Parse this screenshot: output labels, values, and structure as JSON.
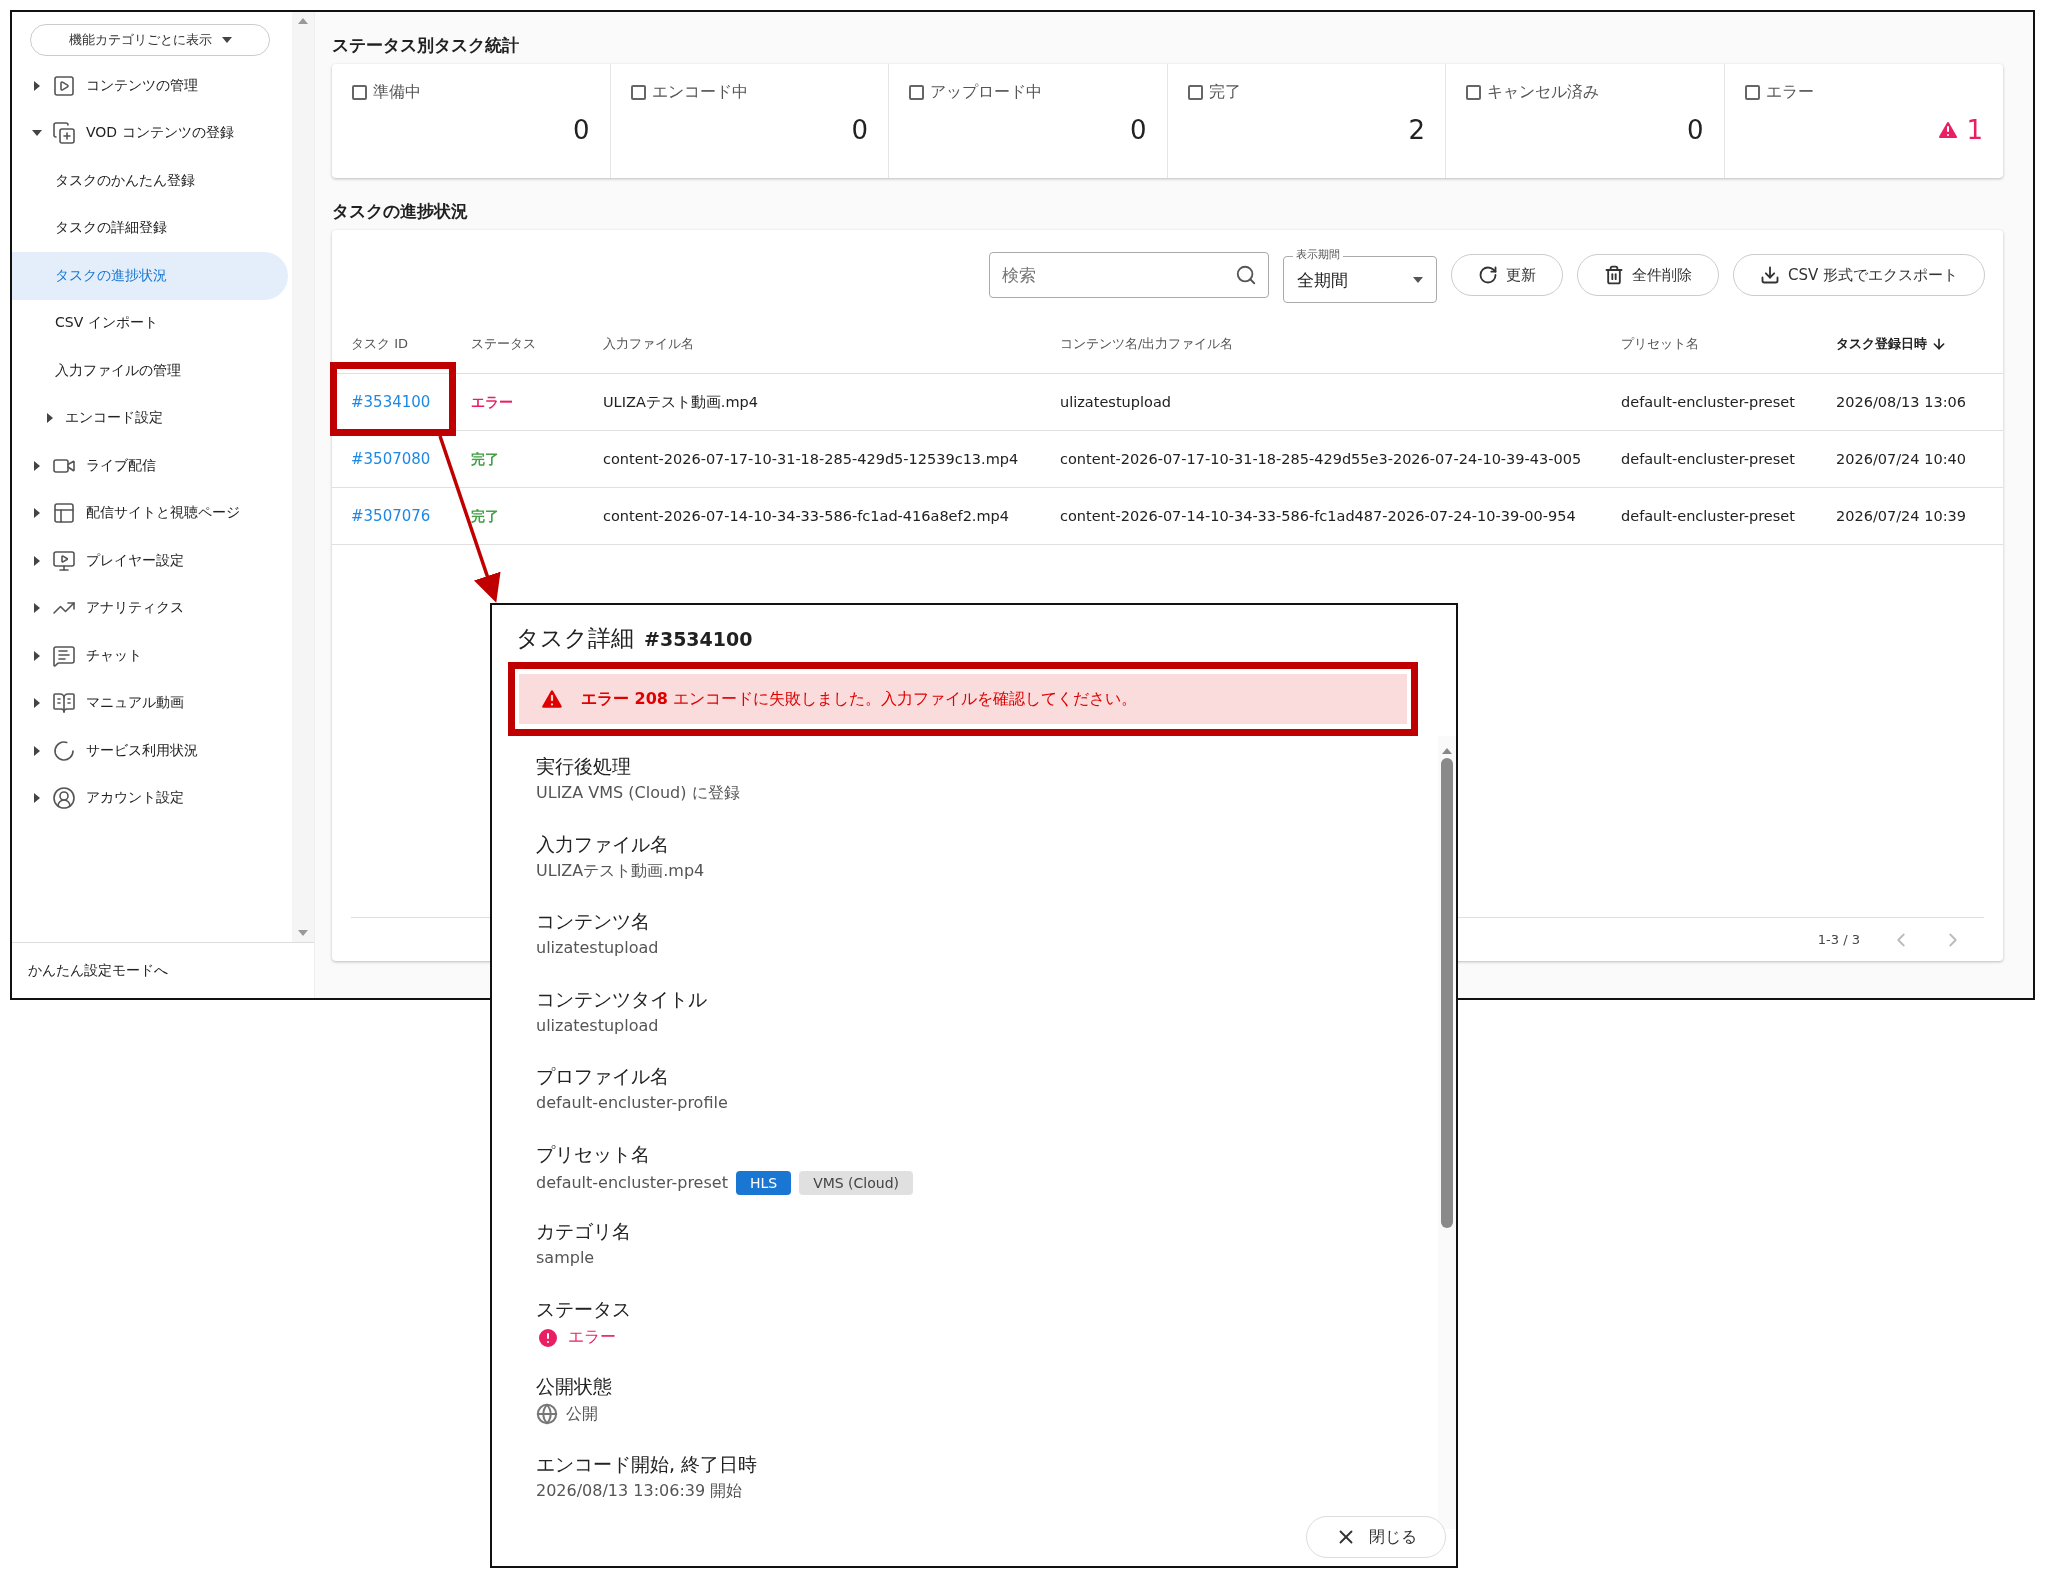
{
  "sidebar": {
    "view_select": "機能カテゴリごとに表示",
    "items": [
      {
        "label": "コンテンツの管理",
        "expanded": false,
        "selected": false
      },
      {
        "label": "VOD コンテンツの登録",
        "expanded": true,
        "selected": false,
        "children": [
          {
            "label": "タスクのかんたん登録",
            "selected": false
          },
          {
            "label": "タスクの詳細登録",
            "selected": false
          },
          {
            "label": "タスクの進捗状況",
            "selected": true
          },
          {
            "label": "CSV インポート",
            "selected": false
          },
          {
            "label": "入力ファイルの管理",
            "selected": false
          },
          {
            "label": "エンコード設定",
            "selected": false,
            "expanded": false
          }
        ]
      },
      {
        "label": "ライブ配信",
        "expanded": false,
        "selected": false
      },
      {
        "label": "配信サイトと視聴ページ",
        "expanded": false,
        "selected": false
      },
      {
        "label": "プレイヤー設定",
        "expanded": false,
        "selected": false
      },
      {
        "label": "アナリティクス",
        "expanded": false,
        "selected": false
      },
      {
        "label": "チャット",
        "expanded": false,
        "selected": false
      },
      {
        "label": "マニュアル動画",
        "expanded": false,
        "selected": false
      },
      {
        "label": "サービス利用状況",
        "expanded": false,
        "selected": false
      },
      {
        "label": "アカウント設定",
        "expanded": false,
        "selected": false
      }
    ],
    "footer_link": "かんたん設定モードへ"
  },
  "stats": {
    "title": "ステータス別タスク統計",
    "cards": [
      {
        "label": "準備中",
        "checked": false,
        "count": "0",
        "kind": "normal"
      },
      {
        "label": "エンコード中",
        "checked": false,
        "count": "0",
        "kind": "normal"
      },
      {
        "label": "アップロード中",
        "checked": false,
        "count": "0",
        "kind": "normal"
      },
      {
        "label": "完了",
        "checked": false,
        "count": "2",
        "kind": "normal"
      },
      {
        "label": "キャンセル済み",
        "checked": false,
        "count": "0",
        "kind": "normal"
      },
      {
        "label": "エラー",
        "checked": false,
        "count": "1",
        "kind": "error"
      }
    ]
  },
  "progress": {
    "title": "タスクの進捗状況",
    "search": {
      "placeholder": "検索"
    },
    "period": {
      "label": "表示期間",
      "value": "全期間"
    },
    "buttons": [
      {
        "label": "更新"
      },
      {
        "label": "全件削除"
      },
      {
        "label": "CSV 形式でエクスポート"
      }
    ],
    "table": {
      "columns": [
        {
          "label": "タスク ID",
          "sorted": false
        },
        {
          "label": "ステータス",
          "sorted": false
        },
        {
          "label": "入力ファイル名",
          "sorted": false
        },
        {
          "label": "コンテンツ名/出力ファイル名",
          "sorted": false
        },
        {
          "label": "プリセット名",
          "sorted": false
        },
        {
          "label": "タスク登録日時",
          "sorted": true
        }
      ],
      "rows": [
        {
          "id": "#3534100",
          "status": "エラー",
          "color": "#e91e63",
          "input": "ULIZAテスト動画.mp4",
          "output": "ulizatestupload",
          "preset": "default-encluster-preset",
          "date": "2026/08/13 13:06"
        },
        {
          "id": "#3507080",
          "status": "完了",
          "color": "#43a047",
          "input": "content-2026-07-17-10-31-18-285-429d5-12539c13.mp4",
          "output": "content-2026-07-17-10-31-18-285-429d55e3-2026-07-24-10-39-43-005",
          "preset": "default-encluster-preset",
          "date": "2026/07/24 10:40"
        },
        {
          "id": "#3507076",
          "status": "完了",
          "color": "#43a047",
          "input": "content-2026-07-14-10-34-33-586-fc1ad-416a8ef2.mp4",
          "output": "content-2026-07-14-10-34-33-586-fc1ad487-2026-07-24-10-39-00-954",
          "preset": "default-encluster-preset",
          "date": "2026/07/24 10:39"
        }
      ]
    },
    "pagination": "1-3 / 3"
  },
  "dialog": {
    "title": "タスク詳細",
    "task_id": "#3534100",
    "alert": {
      "code": "エラー 208",
      "message": "エンコードに失敗しました。入力ファイルを確認してください。"
    },
    "fields": [
      {
        "kind": "text",
        "label": "実行後処理",
        "value": "ULIZA VMS (Cloud) に登録"
      },
      {
        "kind": "text",
        "label": "入力ファイル名",
        "value": "ULIZAテスト動画.mp4"
      },
      {
        "kind": "text",
        "label": "コンテンツ名",
        "value": "ulizatestupload"
      },
      {
        "kind": "text",
        "label": "コンテンツタイトル",
        "value": "ulizatestupload"
      },
      {
        "kind": "text",
        "label": "プロファイル名",
        "value": "default-encluster-profile"
      },
      {
        "kind": "tags",
        "label": "プリセット名",
        "value": "default-encluster-preset",
        "tags": [
          {
            "label": "HLS",
            "color": "#1976d2"
          },
          {
            "label": "VMS (Cloud)",
            "color": "#e0e0e0"
          }
        ]
      },
      {
        "kind": "text",
        "label": "カテゴリ名",
        "value": "sample"
      },
      {
        "kind": "status",
        "label": "ステータス",
        "value": "エラー"
      },
      {
        "kind": "visibility",
        "label": "公開状態",
        "value": "公開"
      },
      {
        "kind": "text",
        "label": "エンコード開始, 終了日時",
        "value": "2026/08/13 13:06:39 開始"
      }
    ],
    "close": "閉じる"
  }
}
